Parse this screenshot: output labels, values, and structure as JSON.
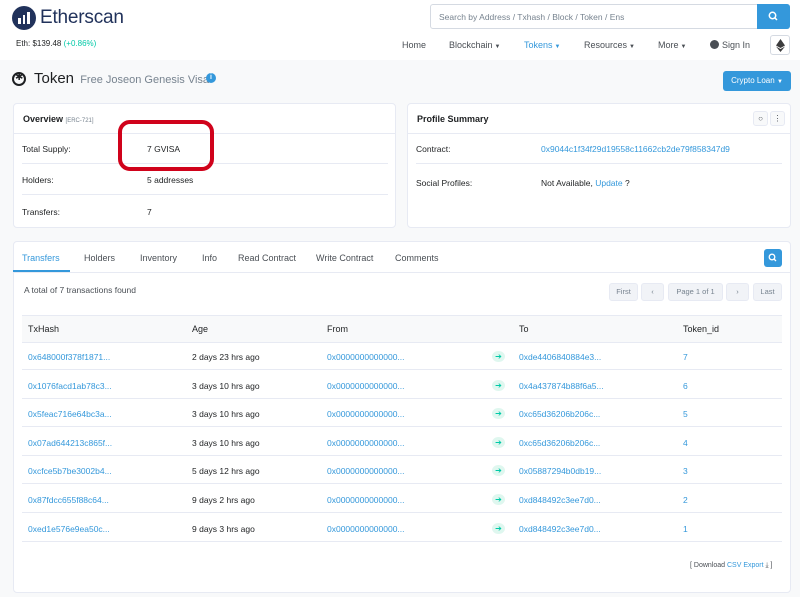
{
  "site": {
    "name": "Etherscan",
    "eth_label": "Eth: $139.48",
    "eth_change": "(+0.86%)"
  },
  "search": {
    "placeholder": "Search by Address / Txhash / Block / Token / Ens"
  },
  "nav": {
    "home": "Home",
    "blockchain": "Blockchain",
    "tokens": "Tokens",
    "resources": "Resources",
    "more": "More",
    "sign_in": "Sign In"
  },
  "page": {
    "title": "Token",
    "token_name": "Free Joseon Genesis Visa",
    "crypto_loan": "Crypto Loan"
  },
  "overview": {
    "title": "Overview",
    "standard": "[ERC-721]",
    "total_supply_label": "Total Supply:",
    "total_supply": "7 GVISA",
    "holders_label": "Holders:",
    "holders": "5 addresses",
    "transfers_label": "Transfers:",
    "transfers": "7"
  },
  "profile": {
    "title": "Profile Summary",
    "contract_label": "Contract:",
    "contract": "0x9044c1f34f29d19558c11662cb2de79f858347d9",
    "social_label": "Social Profiles:",
    "social_value": "Not Available,",
    "update": "Update",
    "question": "?"
  },
  "tabs": [
    "Transfers",
    "Holders",
    "Inventory",
    "Info",
    "Read Contract",
    "Write Contract",
    "Comments"
  ],
  "summary": "A total of 7 transactions found",
  "pagination": {
    "first": "First",
    "prev": "‹",
    "page": "Page 1 of 1",
    "next": "›",
    "last": "Last"
  },
  "table": {
    "headers": [
      "TxHash",
      "Age",
      "From",
      "To",
      "Token_id"
    ],
    "rows": [
      {
        "hash": "0x648000f378f1871...",
        "age": "2 days 23 hrs ago",
        "from": "0x0000000000000...",
        "to": "0xde4406840884e3...",
        "id": "7"
      },
      {
        "hash": "0x1076facd1ab78c3...",
        "age": "3 days 10 hrs ago",
        "from": "0x0000000000000...",
        "to": "0x4a437874b88f6a5...",
        "id": "6"
      },
      {
        "hash": "0x5feac716e64bc3a...",
        "age": "3 days 10 hrs ago",
        "from": "0x0000000000000...",
        "to": "0xc65d36206b206c...",
        "id": "5"
      },
      {
        "hash": "0x07ad644213c865f...",
        "age": "3 days 10 hrs ago",
        "from": "0x0000000000000...",
        "to": "0xc65d36206b206c...",
        "id": "4"
      },
      {
        "hash": "0xcfce5b7be3002b4...",
        "age": "5 days 12 hrs ago",
        "from": "0x0000000000000...",
        "to": "0x05887294b0db19...",
        "id": "3"
      },
      {
        "hash": "0x87fdcc655f88c64...",
        "age": "9 days 2 hrs ago",
        "from": "0x0000000000000...",
        "to": "0xd848492c3ee7d0...",
        "id": "2"
      },
      {
        "hash": "0xed1e576e9ea50c...",
        "age": "9 days 3 hrs ago",
        "from": "0x0000000000000...",
        "to": "0xd848492c3ee7d0...",
        "id": "1"
      }
    ]
  },
  "download": {
    "prefix": "[ Download",
    "link": "CSV Export",
    "suffix": "⤓ ]"
  }
}
